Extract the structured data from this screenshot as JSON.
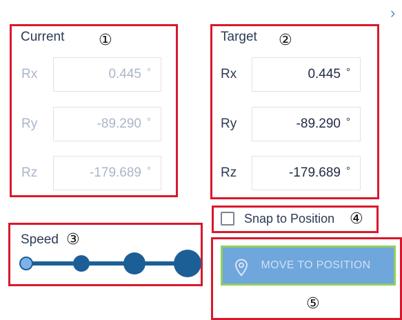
{
  "current": {
    "title": "Current",
    "marker": "①",
    "rows": [
      {
        "label": "Rx",
        "value": "0.445",
        "unit": "°"
      },
      {
        "label": "Ry",
        "value": "-89.290",
        "unit": "°"
      },
      {
        "label": "Rz",
        "value": "-179.689",
        "unit": "°"
      }
    ]
  },
  "target": {
    "title": "Target",
    "marker": "②",
    "rows": [
      {
        "label": "Rx",
        "value": "0.445",
        "unit": "°"
      },
      {
        "label": "Ry",
        "value": "-89.290",
        "unit": "°"
      },
      {
        "label": "Rz",
        "value": "-179.689",
        "unit": "°"
      }
    ]
  },
  "speed": {
    "label": "Speed",
    "marker": "③",
    "levels": 4,
    "selected_level": 1
  },
  "snap": {
    "label": "Snap to Position",
    "marker": "④",
    "checked": false
  },
  "move": {
    "label": "MOVE TO POSITION",
    "marker": "⑤",
    "icon": "location-pin-icon"
  },
  "header": {
    "chevron": "›",
    "icon": "chevron-right-icon"
  },
  "colors": {
    "annotation_red": "#d9182b",
    "text_dark": "#2b3a55",
    "text_muted": "#a9b6c7",
    "speed_blue": "#1c5f96",
    "speed_active": "#7fb2ea",
    "button_blue": "#6fa6dc",
    "button_border_green": "#8fd05c"
  }
}
